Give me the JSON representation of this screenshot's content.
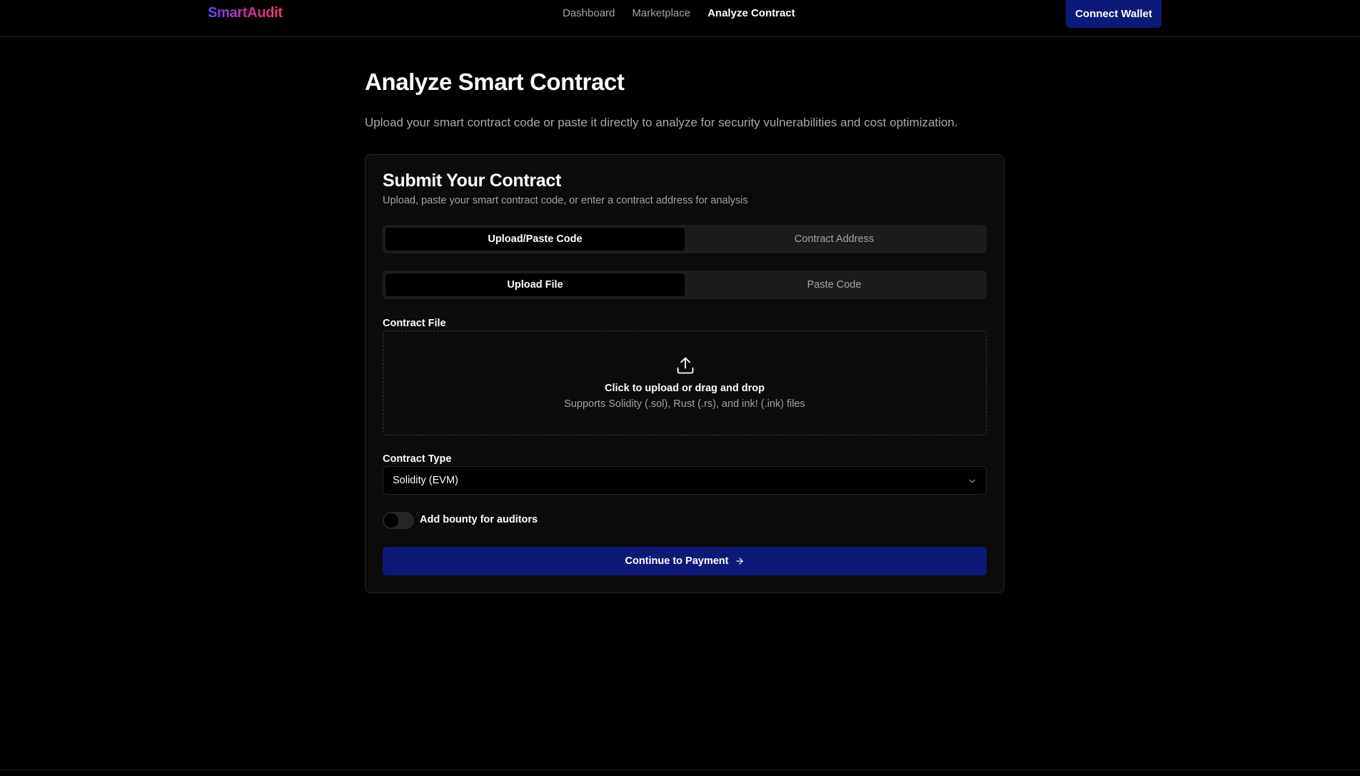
{
  "nav": {
    "logo": "SmartAudit",
    "links": [
      {
        "label": "Dashboard",
        "active": false
      },
      {
        "label": "Marketplace",
        "active": false
      },
      {
        "label": "Analyze Contract",
        "active": true
      }
    ],
    "connect_label": "Connect Wallet"
  },
  "page": {
    "title": "Analyze Smart Contract",
    "subtitle": "Upload your smart contract code or paste it directly to analyze for security vulnerabilities and cost optimization."
  },
  "card": {
    "title": "Submit Your Contract",
    "description": "Upload, paste your smart contract code, or enter a contract address for analysis",
    "source_tabs": [
      {
        "label": "Upload/Paste Code",
        "active": true
      },
      {
        "label": "Contract Address",
        "active": false
      }
    ],
    "input_tabs": [
      {
        "label": "Upload File",
        "active": true
      },
      {
        "label": "Paste Code",
        "active": false
      }
    ],
    "file_label": "Contract File",
    "dropzone": {
      "icon": "upload-icon",
      "title": "Click to upload or drag and drop",
      "hint": "Supports Solidity (.sol), Rust (.rs), and ink! (.ink) files"
    },
    "type_label": "Contract Type",
    "type_value": "Solidity (EVM)",
    "bounty_label": "Add bounty for auditors",
    "bounty_enabled": false,
    "submit_label": "Continue to Payment"
  },
  "colors": {
    "background": "#000000",
    "card": "#0b0b0b",
    "accent": "#0b1a78",
    "muted_text": "#a3a3a3",
    "logo_gradient": [
      "#6f3ff5",
      "#c62fa8",
      "#f0386b"
    ]
  }
}
